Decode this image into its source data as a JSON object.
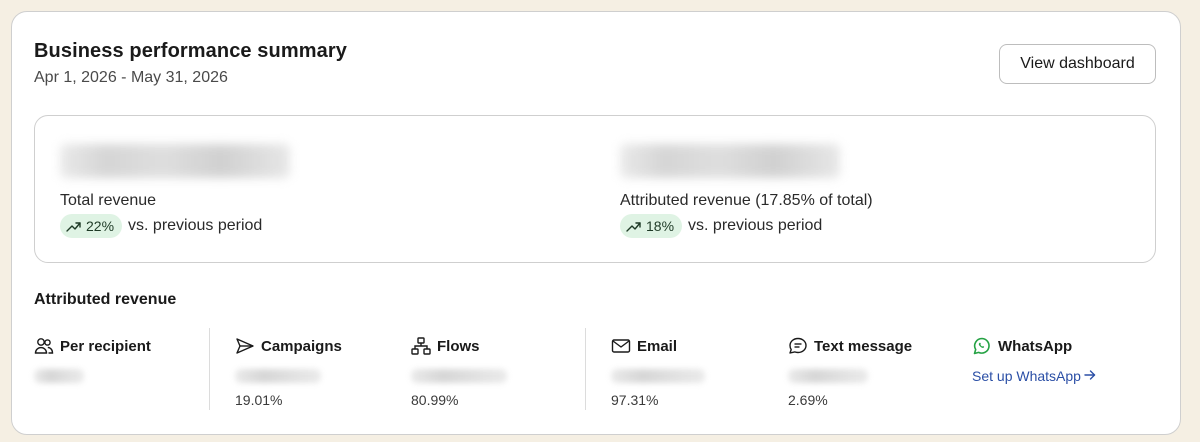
{
  "header": {
    "title": "Business performance summary",
    "date_range": "Apr 1, 2026 - May 31, 2026",
    "view_button_label": "View dashboard"
  },
  "summary": {
    "total": {
      "label": "Total revenue",
      "change": "22%",
      "comparison": "vs. previous period"
    },
    "attributed": {
      "label": "Attributed revenue (17.85% of total)",
      "change": "18%",
      "comparison": "vs. previous period"
    }
  },
  "attributed_section": {
    "title": "Attributed revenue",
    "metrics": [
      {
        "label": "Per recipient",
        "icon": "users-icon",
        "percent": ""
      },
      {
        "label": "Campaigns",
        "icon": "send-icon",
        "percent": "19.01%"
      },
      {
        "label": "Flows",
        "icon": "flows-icon",
        "percent": "80.99%"
      },
      {
        "label": "Email",
        "icon": "envelope-icon",
        "percent": "97.31%"
      },
      {
        "label": "Text message",
        "icon": "message-icon",
        "percent": "2.69%"
      },
      {
        "label": "WhatsApp",
        "icon": "whatsapp-icon",
        "link": "Set up WhatsApp"
      }
    ]
  },
  "colors": {
    "accent_link": "#2b4fa6",
    "positive_pill": "#dff3e4",
    "whatsapp_green": "#25a244"
  }
}
